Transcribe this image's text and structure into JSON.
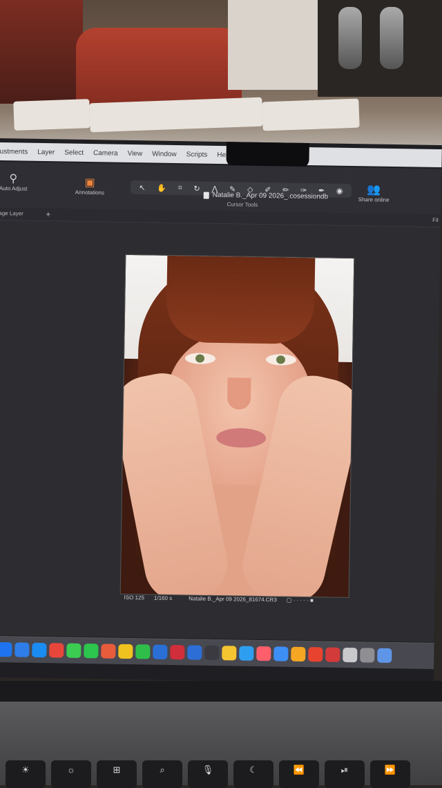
{
  "menubar": {
    "items": [
      "ustments",
      "Layer",
      "Select",
      "Camera",
      "View",
      "Window",
      "Scripts",
      "Help"
    ]
  },
  "document": {
    "title": "Natalie B._Apr 09 2026_.cosessiondb"
  },
  "toolbar": {
    "auto_adjust": "Auto Adjust",
    "annotations": "Annotations",
    "cursor_tools_label": "Cursor Tools",
    "share_online": "Share online",
    "layer_label": "age Layer",
    "right_cut": "Fil"
  },
  "image_info": {
    "iso": "ISO 125",
    "shutter": "1/160 s",
    "filename": "Natalie B._Apr 09 2026_81674.CR3"
  },
  "dock": {
    "apps": [
      "finder-icon",
      "mail-icon",
      "safari-icon",
      "chrome-icon",
      "messages-icon",
      "whatsapp-icon",
      "calendar-icon",
      "notes-icon",
      "facetime-icon",
      "photoshop-icon",
      "keynote-icon",
      "word-icon",
      "music-icon",
      "capture-one-icon",
      "settings-icon",
      "photos-icon",
      "maps-icon",
      "pages-icon",
      "acrobat-icon",
      "disk-utility-icon",
      "dropbox-icon",
      "terminal-icon",
      "files-icon"
    ],
    "colors": [
      "#1e74f0",
      "#2f7de8",
      "#1a8cf2",
      "#e9463b",
      "#3ccc52",
      "#2cc54d",
      "#e85c3c",
      "#f0c21f",
      "#2fbe4a",
      "#2a6fd6",
      "#cf2e3a",
      "#2c6ed6",
      "#3a3a40",
      "#f5c431",
      "#2e9ff0",
      "#ff5f6a",
      "#3d8ef5",
      "#f5a623",
      "#e8432f",
      "#d33a3a",
      "#c9c9cc",
      "#8e8e93",
      "#5f95e8"
    ]
  },
  "keyboard": {
    "keys": [
      "☀",
      "☼",
      "⊞",
      "⌕",
      "🎙",
      "☾",
      "⏪",
      "⏯",
      "⏩"
    ]
  }
}
